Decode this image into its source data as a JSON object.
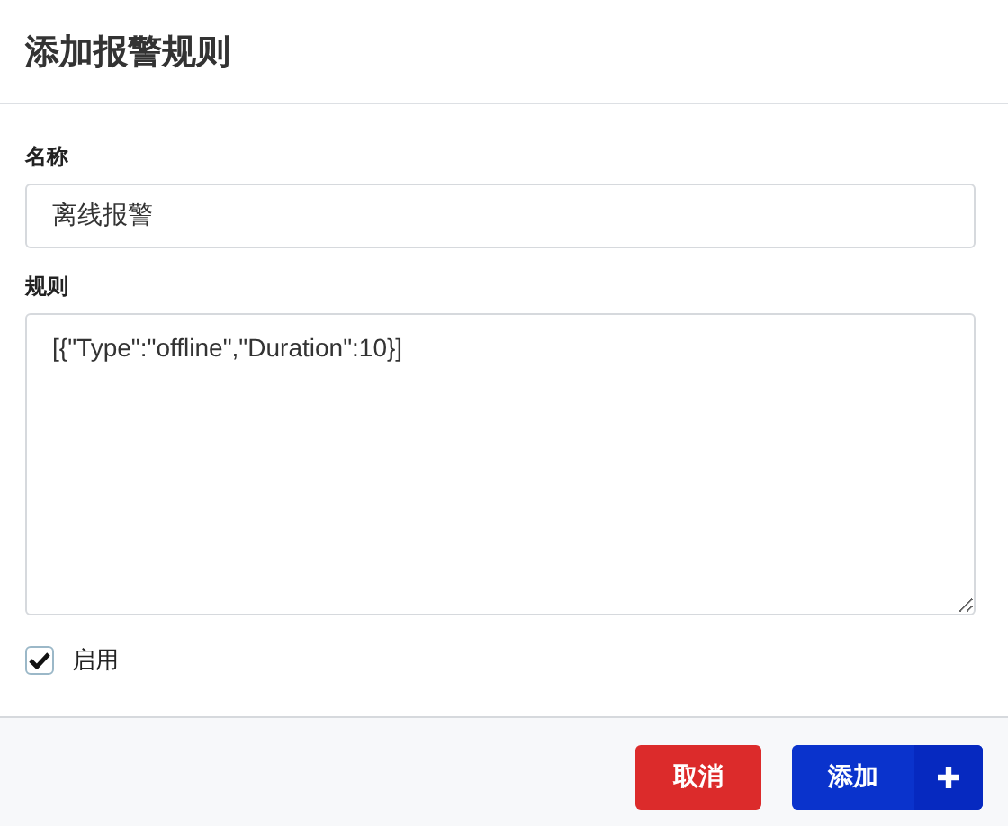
{
  "dialog": {
    "title": "添加报警规则"
  },
  "fields": [
    {
      "kind": "text",
      "label": "名称",
      "value": "离线报警"
    },
    {
      "kind": "textarea",
      "label": "规则",
      "value": "[{\"Type\":\"offline\",\"Duration\":10}]"
    }
  ],
  "enabled": {
    "label": "启用",
    "checked": true
  },
  "buttons": [
    {
      "kind": "cancel",
      "label": "取消"
    },
    {
      "kind": "add",
      "label": "添加"
    }
  ]
}
